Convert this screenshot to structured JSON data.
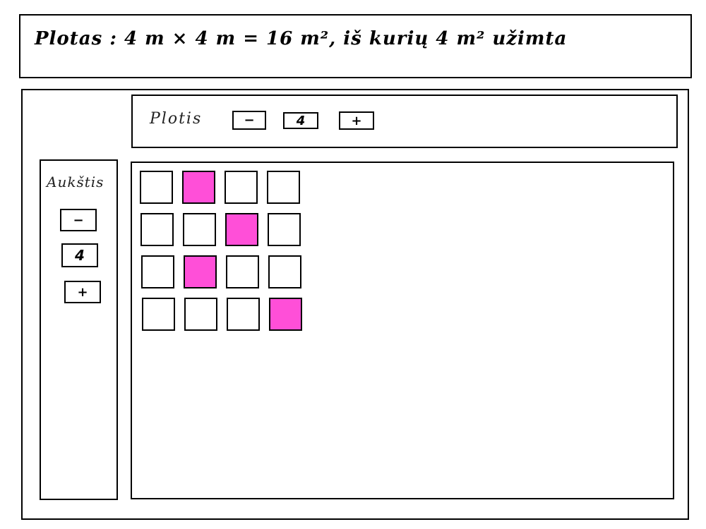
{
  "summary": {
    "text": "Plotas : 4 m × 4 m = 16 m², iš kurių 4 m² užimta"
  },
  "width_control": {
    "label": "Plotis",
    "minus_label": "−",
    "value": "4",
    "plus_label": "+"
  },
  "height_control": {
    "label": "Aukštis",
    "minus_label": "−",
    "value": "4",
    "plus_label": "+"
  },
  "grid": {
    "rows": 4,
    "cols": 4,
    "filled_color": "#ff4fd8",
    "filled_cells": [
      [
        0,
        1
      ],
      [
        1,
        2
      ],
      [
        2,
        1
      ],
      [
        3,
        3
      ]
    ]
  }
}
